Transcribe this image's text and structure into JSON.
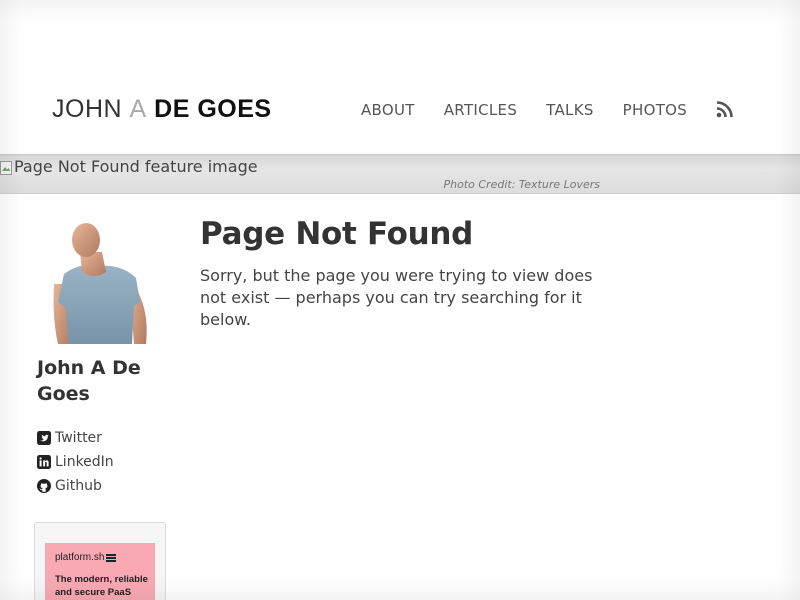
{
  "site": {
    "title_part1": "JOHN",
    "title_part2": "A",
    "title_part3": "DE GOES"
  },
  "nav": {
    "items": [
      {
        "label": "ABOUT"
      },
      {
        "label": "ARTICLES"
      },
      {
        "label": "TALKS"
      },
      {
        "label": "PHOTOS"
      }
    ],
    "rss_icon": "rss-icon"
  },
  "feature": {
    "image_alt": "Page Not Found feature image",
    "credit": "Photo Credit: Texture Lovers"
  },
  "author": {
    "name": "John A De Goes",
    "social": [
      {
        "label": "Twitter",
        "icon": "twitter-icon"
      },
      {
        "label": "LinkedIn",
        "icon": "linkedin-icon"
      },
      {
        "label": "Github",
        "icon": "github-icon"
      }
    ]
  },
  "ad": {
    "logo_text": "platform.sh",
    "tagline": "The modern, reliable and secure PaaS",
    "background": "#f8a9b3"
  },
  "main": {
    "title": "Page Not Found",
    "text": "Sorry, but the page you were trying to view does not exist — perhaps you can try searching for it below."
  },
  "colors": {
    "text": "#333333",
    "nav": "#555555",
    "muted_title": "#aaaaaa"
  }
}
